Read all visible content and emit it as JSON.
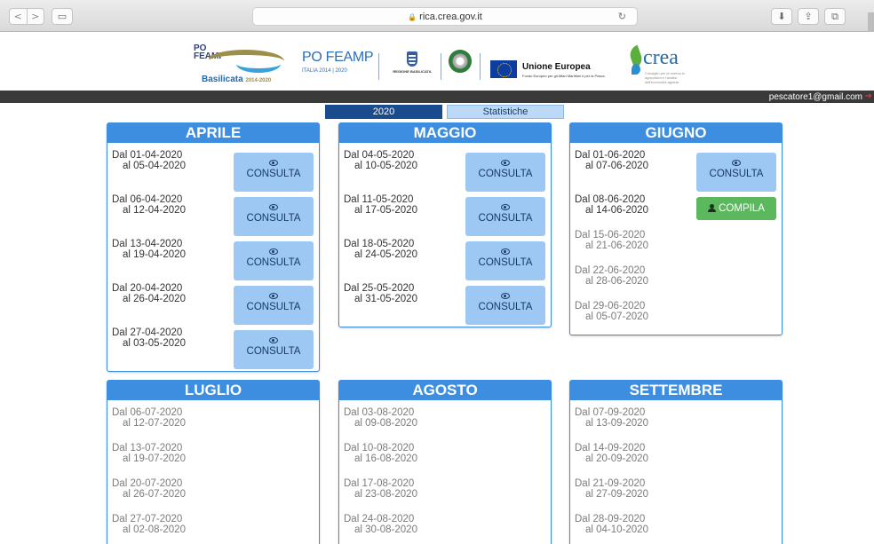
{
  "browser": {
    "url": "rica.crea.gov.it",
    "lock_icon": "🔒",
    "reload_icon": "↻"
  },
  "logos": {
    "basilicata_po": "PO",
    "basilicata_feamp": "FEAMP",
    "basilicata_name": "Basilicata",
    "basilicata_years": "2014-2020",
    "feamp_title": "PO FEAMP",
    "feamp_sub": "ITALIA   2014 | 2020",
    "regione": "REGIONE BASILICATA",
    "eu_title": "Unione Europea",
    "eu_sub": "Fondo Europeo per gli Affari Marittimi e per la Pesca",
    "crea": "crea",
    "crea_sub": "Consiglio per la ricerca in agricoltura e l'analisi dell'economia agraria"
  },
  "user": {
    "email": "pescatore1@gmail.com",
    "logout_icon": "➔"
  },
  "tabs": {
    "year": "2020",
    "stats": "Statistiche"
  },
  "labels": {
    "consulta": "CONSULTA",
    "compila": "COMPILA"
  },
  "months": [
    {
      "name": "APRILE",
      "weeks": [
        {
          "from": "Dal 01-04-2020",
          "to": "al 05-04-2020",
          "action": "consulta"
        },
        {
          "from": "Dal 06-04-2020",
          "to": "al 12-04-2020",
          "action": "consulta"
        },
        {
          "from": "Dal 13-04-2020",
          "to": "al 19-04-2020",
          "action": "consulta"
        },
        {
          "from": "Dal 20-04-2020",
          "to": "al 26-04-2020",
          "action": "consulta"
        },
        {
          "from": "Dal 27-04-2020",
          "to": "al 03-05-2020",
          "action": "consulta"
        }
      ]
    },
    {
      "name": "MAGGIO",
      "weeks": [
        {
          "from": "Dal 04-05-2020",
          "to": "al 10-05-2020",
          "action": "consulta"
        },
        {
          "from": "Dal 11-05-2020",
          "to": "al 17-05-2020",
          "action": "consulta"
        },
        {
          "from": "Dal 18-05-2020",
          "to": "al 24-05-2020",
          "action": "consulta"
        },
        {
          "from": "Dal 25-05-2020",
          "to": "al 31-05-2020",
          "action": "consulta"
        }
      ]
    },
    {
      "name": "GIUGNO",
      "weeks": [
        {
          "from": "Dal 01-06-2020",
          "to": "al 07-06-2020",
          "action": "consulta"
        },
        {
          "from": "Dal 08-06-2020",
          "to": "al 14-06-2020",
          "action": "compila"
        },
        {
          "from": "Dal 15-06-2020",
          "to": "al 21-06-2020",
          "action": "none"
        },
        {
          "from": "Dal 22-06-2020",
          "to": "al 28-06-2020",
          "action": "none"
        },
        {
          "from": "Dal 29-06-2020",
          "to": "al 05-07-2020",
          "action": "none"
        }
      ]
    },
    {
      "name": "LUGLIO",
      "weeks": [
        {
          "from": "Dal 06-07-2020",
          "to": "al 12-07-2020",
          "action": "none"
        },
        {
          "from": "Dal 13-07-2020",
          "to": "al 19-07-2020",
          "action": "none"
        },
        {
          "from": "Dal 20-07-2020",
          "to": "al 26-07-2020",
          "action": "none"
        },
        {
          "from": "Dal 27-07-2020",
          "to": "al 02-08-2020",
          "action": "none"
        }
      ]
    },
    {
      "name": "AGOSTO",
      "weeks": [
        {
          "from": "Dal 03-08-2020",
          "to": "al 09-08-2020",
          "action": "none"
        },
        {
          "from": "Dal 10-08-2020",
          "to": "al 16-08-2020",
          "action": "none"
        },
        {
          "from": "Dal 17-08-2020",
          "to": "al 23-08-2020",
          "action": "none"
        },
        {
          "from": "Dal 24-08-2020",
          "to": "al 30-08-2020",
          "action": "none"
        }
      ]
    },
    {
      "name": "SETTEMBRE",
      "weeks": [
        {
          "from": "Dal 07-09-2020",
          "to": "al 13-09-2020",
          "action": "none"
        },
        {
          "from": "Dal 14-09-2020",
          "to": "al 20-09-2020",
          "action": "none"
        },
        {
          "from": "Dal 21-09-2020",
          "to": "al 27-09-2020",
          "action": "none"
        },
        {
          "from": "Dal 28-09-2020",
          "to": "al 04-10-2020",
          "action": "none"
        }
      ]
    }
  ]
}
